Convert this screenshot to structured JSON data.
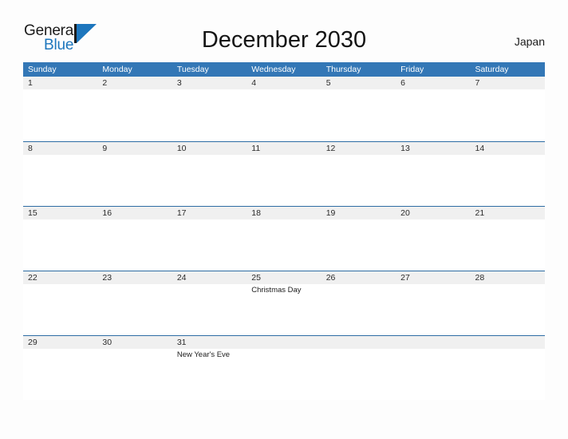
{
  "brand": {
    "name_part1": "General",
    "name_part2": "Blue",
    "logo_icon": "general-blue-sail-logo",
    "accent_color": "#1d76bd",
    "dark_color": "#1b1b1b"
  },
  "header": {
    "title": "December 2030",
    "locale": "Japan"
  },
  "colors": {
    "weekday_header_bg": "#3377b6",
    "weekday_header_text": "#ffffff",
    "row_separator": "#2e6da4",
    "daynum_band_bg": "#f0f0f0",
    "page_bg": "#fdfdfd"
  },
  "calendar": {
    "weekdays": [
      "Sunday",
      "Monday",
      "Tuesday",
      "Wednesday",
      "Thursday",
      "Friday",
      "Saturday"
    ],
    "weeks": [
      {
        "days": [
          {
            "num": "1",
            "event": ""
          },
          {
            "num": "2",
            "event": ""
          },
          {
            "num": "3",
            "event": ""
          },
          {
            "num": "4",
            "event": ""
          },
          {
            "num": "5",
            "event": ""
          },
          {
            "num": "6",
            "event": ""
          },
          {
            "num": "7",
            "event": ""
          }
        ]
      },
      {
        "days": [
          {
            "num": "8",
            "event": ""
          },
          {
            "num": "9",
            "event": ""
          },
          {
            "num": "10",
            "event": ""
          },
          {
            "num": "11",
            "event": ""
          },
          {
            "num": "12",
            "event": ""
          },
          {
            "num": "13",
            "event": ""
          },
          {
            "num": "14",
            "event": ""
          }
        ]
      },
      {
        "days": [
          {
            "num": "15",
            "event": ""
          },
          {
            "num": "16",
            "event": ""
          },
          {
            "num": "17",
            "event": ""
          },
          {
            "num": "18",
            "event": ""
          },
          {
            "num": "19",
            "event": ""
          },
          {
            "num": "20",
            "event": ""
          },
          {
            "num": "21",
            "event": ""
          }
        ]
      },
      {
        "days": [
          {
            "num": "22",
            "event": ""
          },
          {
            "num": "23",
            "event": ""
          },
          {
            "num": "24",
            "event": ""
          },
          {
            "num": "25",
            "event": "Christmas Day"
          },
          {
            "num": "26",
            "event": ""
          },
          {
            "num": "27",
            "event": ""
          },
          {
            "num": "28",
            "event": ""
          }
        ]
      },
      {
        "days": [
          {
            "num": "29",
            "event": ""
          },
          {
            "num": "30",
            "event": ""
          },
          {
            "num": "31",
            "event": "New Year's Eve"
          },
          {
            "num": "",
            "event": ""
          },
          {
            "num": "",
            "event": ""
          },
          {
            "num": "",
            "event": ""
          },
          {
            "num": "",
            "event": ""
          }
        ]
      }
    ]
  }
}
